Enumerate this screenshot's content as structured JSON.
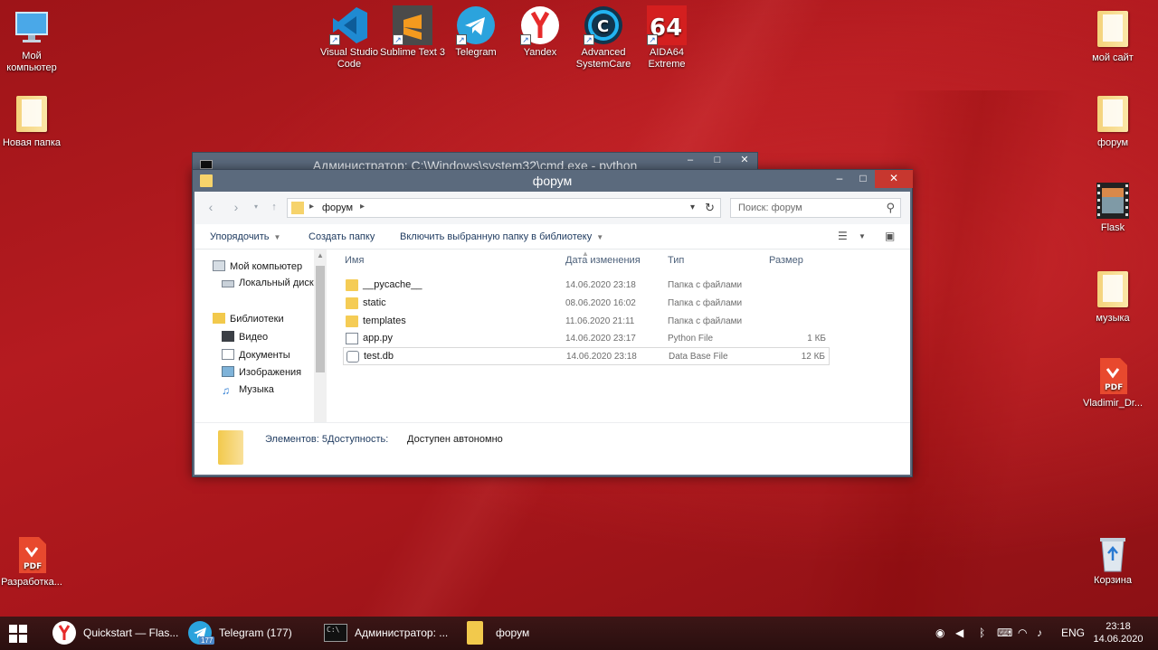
{
  "desktop": {
    "icons_left": [
      {
        "label": "Мой компьютер",
        "icon": "computer-icon"
      },
      {
        "label": "Новая папка",
        "icon": "folder-icon"
      },
      {
        "label": "Разработка...",
        "icon": "pdf-icon"
      }
    ],
    "icons_top": [
      {
        "label": "Visual Studio Code",
        "icon": "vscode-icon"
      },
      {
        "label": "Sublime Text 3",
        "icon": "sublime-icon"
      },
      {
        "label": "Telegram",
        "icon": "telegram-icon"
      },
      {
        "label": "Yandex",
        "icon": "yandex-icon"
      },
      {
        "label": "Advanced SystemCare",
        "icon": "systemcare-icon"
      },
      {
        "label": "AIDA64 Extreme",
        "icon": "aida64-icon"
      }
    ],
    "icons_right": [
      {
        "label": "мой сайт",
        "icon": "folder-icon"
      },
      {
        "label": "форум",
        "icon": "folder-icon"
      },
      {
        "label": "Flask",
        "icon": "film-icon"
      },
      {
        "label": "музыка",
        "icon": "folder-icon"
      },
      {
        "label": "Vladimir_Dr...",
        "icon": "pdf-icon"
      },
      {
        "label": "Корзина",
        "icon": "recycle-bin-icon"
      }
    ]
  },
  "cmd_window": {
    "title": "Администратор: C:\\Windows\\system32\\cmd.exe - python"
  },
  "explorer": {
    "title": "форум",
    "address": {
      "current": "форум"
    },
    "search": {
      "placeholder": "Поиск: форум"
    },
    "toolbar": {
      "organize": "Упорядочить",
      "new_folder": "Создать папку",
      "include_library": "Включить выбранную папку в библиотеку"
    },
    "nav": {
      "computer": "Мой компьютер",
      "local_disk": "Локальный диск",
      "libraries": "Библиотеки",
      "video": "Видео",
      "documents": "Документы",
      "images": "Изображения",
      "music": "Музыка"
    },
    "columns": {
      "name": "Имя",
      "date": "Дата изменения",
      "type": "Тип",
      "size": "Размер"
    },
    "files": [
      {
        "name": "__pycache__",
        "date": "14.06.2020 23:18",
        "type": "Папка с файлами",
        "size": "",
        "kind": "folder"
      },
      {
        "name": "static",
        "date": "08.06.2020 16:02",
        "type": "Папка с файлами",
        "size": "",
        "kind": "folder"
      },
      {
        "name": "templates",
        "date": "11.06.2020 21:11",
        "type": "Папка с файлами",
        "size": "",
        "kind": "folder"
      },
      {
        "name": "app.py",
        "date": "14.06.2020 23:17",
        "type": "Python File",
        "size": "1 КБ",
        "kind": "python"
      },
      {
        "name": "test.db",
        "date": "14.06.2020 23:18",
        "type": "Data Base File",
        "size": "12 КБ",
        "kind": "db"
      }
    ],
    "status": {
      "items_label": "Элементов: 5",
      "availability_label": "Доступность:",
      "availability_value": "Доступен автономно"
    }
  },
  "taskbar": {
    "items": [
      {
        "label": "Quickstart — Flas...",
        "icon": "yandex-icon"
      },
      {
        "label": "Telegram (177)",
        "icon": "telegram-icon",
        "badge": "177"
      },
      {
        "label": "Администратор: ...",
        "icon": "cmd-icon"
      },
      {
        "label": "форум",
        "icon": "folder-icon"
      }
    ],
    "language": "ENG",
    "time": "23:18",
    "date": "14.06.2020"
  }
}
